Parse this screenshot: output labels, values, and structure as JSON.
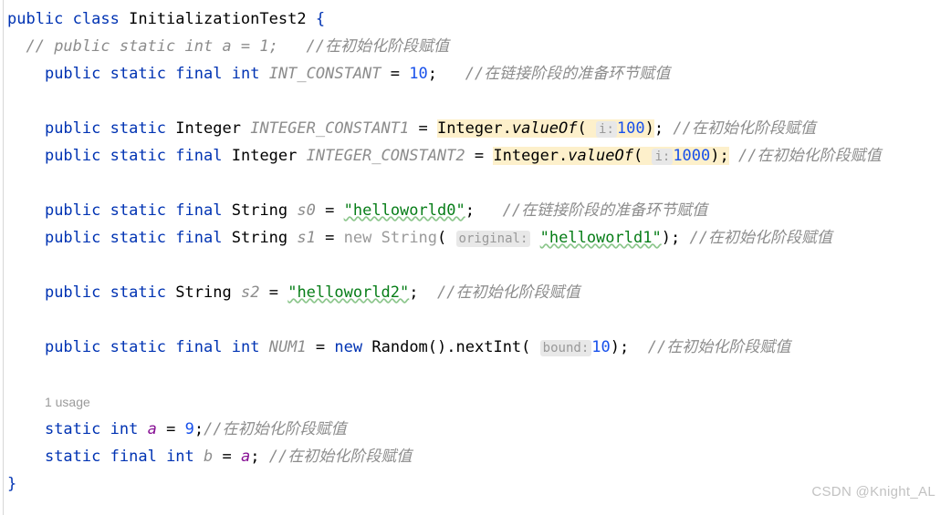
{
  "editor": {
    "language": "java",
    "background": "#ffffff",
    "highlight_color": "#fdf0cb",
    "hint_chip_color": "#e8e8e8"
  },
  "colors": {
    "keyword": "#0033b3",
    "string": "#067d17",
    "number": "#1750eb",
    "comment": "#8c8c8c",
    "field": "#871094",
    "constant": "#8c8c8c",
    "dimmed": "#9a9a9a"
  },
  "comments": {
    "init_stage": "//在初始化阶段赋值",
    "link_stage": "//在链接阶段的准备环节赋值"
  },
  "hints": {
    "i": "i:",
    "original": "original:",
    "bound": "bound:"
  },
  "code": {
    "l1": {
      "kw_public": "public",
      "kw_class": "class",
      "class_name": "InitializationTest2",
      "brace": "{"
    },
    "l2": {
      "comment": "// public static int a = 1;",
      "trailing_comment": "//在初始化阶段赋值"
    },
    "l3": {
      "kw_public": "public",
      "kw_static": "static",
      "kw_final": "final",
      "kw_int": "int",
      "name": "INT_CONSTANT",
      "eq": "=",
      "value": "10",
      "semi": ";",
      "trailing_comment": "//在链接阶段的准备环节赋值"
    },
    "l5": {
      "kw_public": "public",
      "kw_static": "static",
      "type": "Integer",
      "name": "INTEGER_CONSTANT1",
      "eq": "=",
      "recv": "Integer",
      "dot": ".",
      "method": "valueOf",
      "paren_open": "(",
      "hint": "i:",
      "value": "100",
      "paren_close": ")",
      "semi": ";",
      "trailing_comment": "//在初始化阶段赋值"
    },
    "l6": {
      "kw_public": "public",
      "kw_static": "static",
      "kw_final": "final",
      "type": "Integer",
      "name": "INTEGER_CONSTANT2",
      "eq": "=",
      "recv": "Integer",
      "dot": ".",
      "method": "valueOf",
      "paren_open": "(",
      "hint": "i:",
      "value": "1000",
      "paren_close": ")",
      "semi": ";",
      "trailing_comment": "//在初始化阶段赋值"
    },
    "l8": {
      "kw_public": "public",
      "kw_static": "static",
      "kw_final": "final",
      "type": "String",
      "name": "s0",
      "eq": "=",
      "value": "\"helloworld0\"",
      "semi": ";",
      "trailing_comment": "//在链接阶段的准备环节赋值"
    },
    "l9": {
      "kw_public": "public",
      "kw_static": "static",
      "kw_final": "final",
      "type": "String",
      "name": "s1",
      "eq": "=",
      "kw_new": "new",
      "ctor": "String",
      "paren_open": "(",
      "hint": "original:",
      "value": "\"helloworld1\"",
      "paren_close": ")",
      "semi": ";",
      "trailing_comment": "//在初始化阶段赋值"
    },
    "l11": {
      "kw_public": "public",
      "kw_static": "static",
      "type": "String",
      "name": "s2",
      "eq": "=",
      "value": "\"helloworld2\"",
      "semi": ";",
      "trailing_comment": "//在初始化阶段赋值"
    },
    "l13": {
      "kw_public": "public",
      "kw_static": "static",
      "kw_final": "final",
      "kw_int": "int",
      "name": "NUM1",
      "eq": "=",
      "kw_new": "new",
      "ctor": "Random()",
      "dot": ".",
      "method": "nextInt",
      "paren_open": "(",
      "hint": "bound:",
      "value": "10",
      "paren_close": ")",
      "semi": ";",
      "trailing_comment": "//在初始化阶段赋值"
    },
    "l15": {
      "usage_hint": "1 usage"
    },
    "l16": {
      "kw_static": "static",
      "kw_int": "int",
      "name": "a",
      "eq": "=",
      "value": "9",
      "semi": ";",
      "trailing_comment": "//在初始化阶段赋值"
    },
    "l17": {
      "kw_static": "static",
      "kw_final": "final",
      "kw_int": "int",
      "name": "b",
      "eq": "=",
      "value": "a",
      "semi": ";",
      "trailing_comment": "//在初始化阶段赋值"
    },
    "l18": {
      "brace": "}"
    }
  },
  "watermark": "CSDN @Knight_AL"
}
